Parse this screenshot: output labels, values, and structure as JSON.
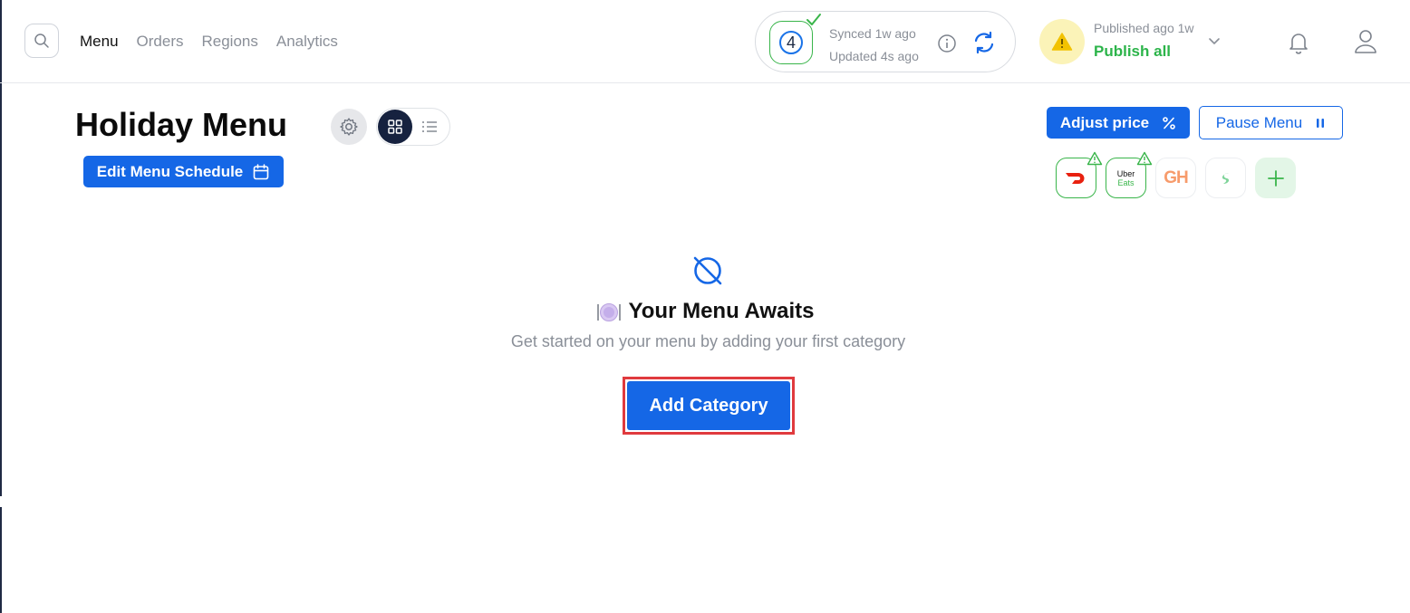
{
  "nav": {
    "items": [
      "Menu",
      "Orders",
      "Regions",
      "Analytics"
    ],
    "active": "Menu"
  },
  "sync": {
    "count": "4",
    "synced": "Synced 1w ago",
    "updated": "Updated 4s ago"
  },
  "publish": {
    "label": "Published ago 1w",
    "action": "Publish all"
  },
  "menu": {
    "title": "Holiday Menu",
    "edit_schedule": "Edit Menu Schedule",
    "adjust_price": "Adjust price",
    "pause_menu": "Pause Menu"
  },
  "platforms": {
    "uber_line1": "Uber",
    "uber_line2": "Eats",
    "gh": "GH"
  },
  "empty_state": {
    "title": "Your Menu Awaits",
    "subtitle": "Get started on your menu by adding your first category",
    "add_category": "Add Category"
  },
  "colors": {
    "primary": "#1567e6",
    "success": "#2cb44a",
    "highlight": "#e03a3e",
    "dark": "#16223f"
  },
  "icons": [
    "search-icon",
    "check-icon",
    "info-icon",
    "refresh-icon",
    "warning-icon",
    "chevron-down-icon",
    "bell-icon",
    "user-icon",
    "gear-icon",
    "grid-icon",
    "list-icon",
    "calendar-icon",
    "percent-icon",
    "pause-icon",
    "doordash-icon",
    "ubereats-icon",
    "grubhub-icon",
    "platform-icon",
    "plus-icon",
    "no-menu-icon",
    "plate-icon"
  ]
}
